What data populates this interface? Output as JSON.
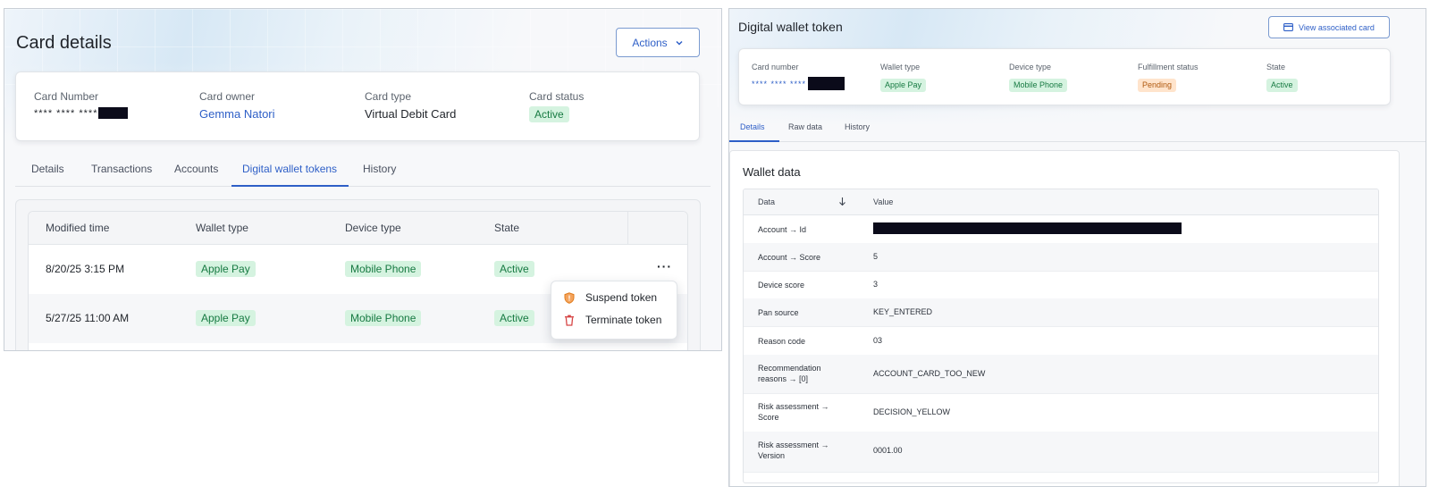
{
  "card_details": {
    "title": "Card details",
    "actions_label": "Actions",
    "summary": {
      "card_number_label": "Card Number",
      "card_number_value": "**** **** ****",
      "card_owner_label": "Card owner",
      "card_owner_value": "Gemma Natori",
      "card_type_label": "Card type",
      "card_type_value": "Virtual Debit Card",
      "card_status_label": "Card status",
      "card_status_value": "Active"
    },
    "tabs": [
      {
        "label": "Details"
      },
      {
        "label": "Transactions"
      },
      {
        "label": "Accounts"
      },
      {
        "label": "Digital wallet tokens"
      },
      {
        "label": "History"
      }
    ],
    "active_tab": "Digital wallet tokens",
    "table": {
      "columns": [
        "Modified time",
        "Wallet type",
        "Device type",
        "State"
      ],
      "rows": [
        {
          "modified": "8/20/25 3:15 PM",
          "wallet": "Apple Pay",
          "device": "Mobile Phone",
          "state": "Active"
        },
        {
          "modified": "5/27/25 11:00 AM",
          "wallet": "Apple Pay",
          "device": "Mobile Phone",
          "state": "Active"
        }
      ],
      "row_menu_label": "···"
    },
    "context_menu": {
      "items": [
        {
          "label": "Suspend token",
          "icon": "shield-alert-icon",
          "color": "#e07b1a"
        },
        {
          "label": "Terminate token",
          "icon": "trash-icon",
          "color": "#d64545"
        }
      ]
    }
  },
  "token_details": {
    "title": "Digital wallet token",
    "view_card_label": "View associated card",
    "summary": {
      "card_number_label": "Card number",
      "card_number_value": "**** **** ****",
      "wallet_type_label": "Wallet type",
      "wallet_type_value": "Apple Pay",
      "device_type_label": "Device type",
      "device_type_value": "Mobile Phone",
      "fulfillment_label": "Fulfillment status",
      "fulfillment_value": "Pending",
      "state_label": "State",
      "state_value": "Active"
    },
    "tabs": [
      {
        "label": "Details"
      },
      {
        "label": "Raw data"
      },
      {
        "label": "History"
      }
    ],
    "active_tab": "Details",
    "wallet_data": {
      "heading": "Wallet data",
      "col_data": "Data",
      "col_value": "Value",
      "rows": [
        {
          "key": "Account → Id",
          "value": ""
        },
        {
          "key": "Account → Score",
          "value": "5"
        },
        {
          "key": "Device score",
          "value": "3"
        },
        {
          "key": "Pan source",
          "value": "KEY_ENTERED"
        },
        {
          "key": "Reason code",
          "value": "03"
        },
        {
          "key": "Recommendation reasons → [0]",
          "value": "ACCOUNT_CARD_TOO_NEW"
        },
        {
          "key": "Risk assessment → Score",
          "value": "DECISION_YELLOW"
        },
        {
          "key": "Risk assessment → Version",
          "value": "0001.00"
        }
      ]
    }
  },
  "colors": {
    "accent": "#2e5fc7",
    "success_bg": "#d5f3e0",
    "success_text": "#177a42",
    "warning_bg": "#ffe4cc",
    "warning_text": "#b05a10",
    "redaction": "#0b0b1a"
  }
}
